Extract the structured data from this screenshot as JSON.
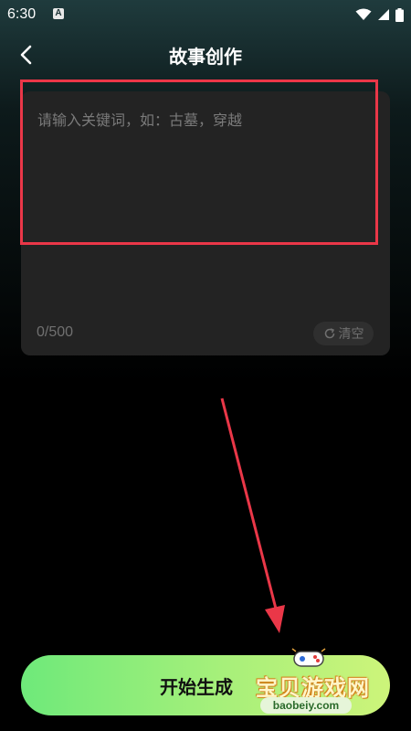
{
  "status_bar": {
    "time": "6:30",
    "notification_letter": "A"
  },
  "header": {
    "title": "故事创作"
  },
  "editor": {
    "placeholder": "请输入关键词，如：古墓，穿越",
    "value": "",
    "counter": "0/500",
    "clear_label": "清空"
  },
  "actions": {
    "generate_label": "开始生成"
  },
  "watermark": {
    "brand": "宝贝游戏网",
    "url": "baobeiy.com"
  },
  "colors": {
    "annotation": "#ea3748",
    "button_start": "#6ee97a",
    "button_end": "#cdf47a"
  }
}
